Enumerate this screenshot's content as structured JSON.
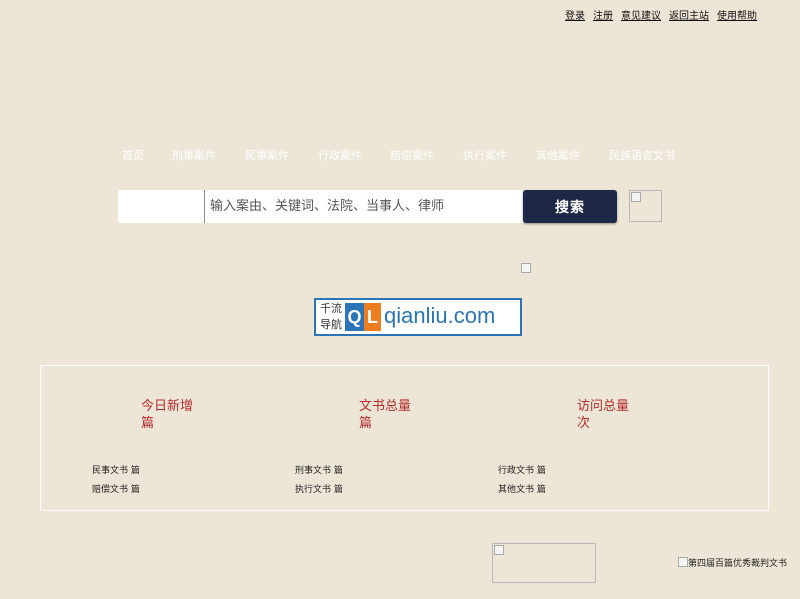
{
  "top_links": [
    "登录",
    "注册",
    "意见建议",
    "返回主站",
    "使用帮助"
  ],
  "nav": [
    "首页",
    "刑事案件",
    "民事案件",
    "行政案件",
    "赔偿案件",
    "执行案件",
    "其他案件",
    "民族语言文书"
  ],
  "search": {
    "type_value": "",
    "placeholder": "输入案由、关键词、法院、当事人、律师",
    "button": "搜索"
  },
  "logo": {
    "cn_line1": "千流",
    "cn_line2": "导航",
    "q": "Q",
    "l": "L",
    "domain": "qianliu.com"
  },
  "stats": {
    "today": {
      "label": "今日新增",
      "unit": "篇"
    },
    "total": {
      "label": "文书总量",
      "unit": "篇"
    },
    "visits": {
      "label": "访问总量",
      "unit": "次"
    },
    "breakdown": [
      {
        "label": "民事文书",
        "unit": "篇"
      },
      {
        "label": "刑事文书",
        "unit": "篇"
      },
      {
        "label": "行政文书",
        "unit": "篇"
      },
      {
        "label": "赔偿文书",
        "unit": "篇"
      },
      {
        "label": "执行文书",
        "unit": "篇"
      },
      {
        "label": "其他文书",
        "unit": "篇"
      }
    ]
  },
  "footer_image_alt": "第四届百篇优秀裁判文书"
}
